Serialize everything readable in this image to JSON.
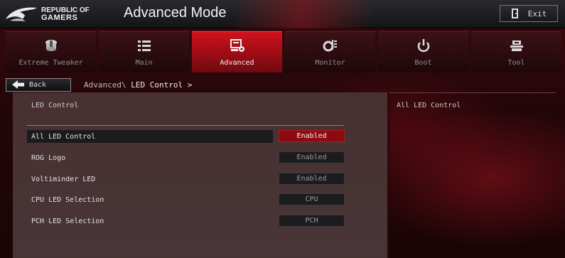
{
  "header": {
    "brand_line1": "REPUBLIC OF",
    "brand_line2": "GAMERS",
    "title": "Advanced Mode",
    "exit_label": "Exit"
  },
  "tabs": [
    {
      "label": "Extreme Tweaker",
      "icon": "tweaker-icon"
    },
    {
      "label": "Main",
      "icon": "list-icon"
    },
    {
      "label": "Advanced",
      "icon": "advanced-icon",
      "active": true
    },
    {
      "label": "Monitor",
      "icon": "monitor-icon"
    },
    {
      "label": "Boot",
      "icon": "power-icon"
    },
    {
      "label": "Tool",
      "icon": "tool-icon"
    }
  ],
  "nav": {
    "back_label": "Back",
    "breadcrumb_parent": "Advanced\\",
    "breadcrumb_current": "LED Control >"
  },
  "section": {
    "title": "LED Control"
  },
  "settings": [
    {
      "label": "All LED Control",
      "value": "Enabled",
      "selected": true
    },
    {
      "label": "ROG Logo",
      "value": "Enabled"
    },
    {
      "label": "Voltiminder LED",
      "value": "Enabled"
    },
    {
      "label": "CPU LED Selection",
      "value": "CPU"
    },
    {
      "label": "PCH LED Selection",
      "value": "PCH"
    }
  ],
  "help": {
    "text": "All LED Control"
  },
  "colors": {
    "accent_red": "#c8101a",
    "selected_value_bg": "#8c0b12",
    "panel_bg": "#2a0a0c"
  }
}
